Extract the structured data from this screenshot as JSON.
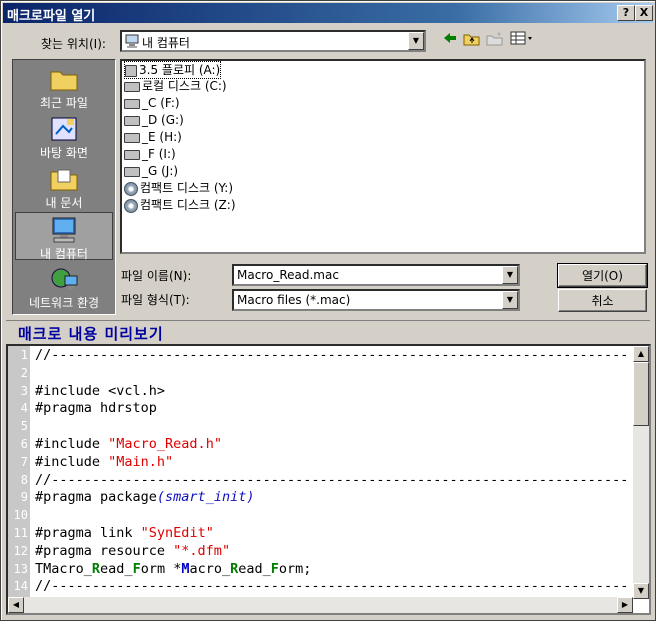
{
  "window": {
    "title": "매크로파일 열기",
    "help_btn": "?",
    "close_btn": "X"
  },
  "lookin": {
    "label": "찾는 위치(I):",
    "value": "내 컴퓨터"
  },
  "places": [
    {
      "label": "최근 파일",
      "icon": "folder-icon"
    },
    {
      "label": "바탕 화면",
      "icon": "desktop-icon"
    },
    {
      "label": "내 문서",
      "icon": "documents-folder-icon"
    },
    {
      "label": "내 컴퓨터",
      "icon": "computer-icon",
      "selected": true
    },
    {
      "label": "네트워크 환경",
      "icon": "network-icon"
    }
  ],
  "files": [
    {
      "name": "3.5 플로피 (A:)",
      "icon": "floppy-icon"
    },
    {
      "name": "로컬 디스크 (C:)",
      "icon": "drive-icon"
    },
    {
      "name": "_C (F:)",
      "icon": "drive-icon"
    },
    {
      "name": "_D (G:)",
      "icon": "drive-icon"
    },
    {
      "name": "_E (H:)",
      "icon": "drive-icon"
    },
    {
      "name": "_F (I:)",
      "icon": "drive-icon"
    },
    {
      "name": "_G (J:)",
      "icon": "drive-icon"
    },
    {
      "name": "컴팩트 디스크 (Y:)",
      "icon": "cd-icon"
    },
    {
      "name": "컴팩트 디스크 (Z:)",
      "icon": "cd-icon"
    }
  ],
  "filename": {
    "label": "파일 이름(N):",
    "value": "Macro_Read.mac"
  },
  "filetype": {
    "label": "파일 형식(T):",
    "value": "Macro files (*.mac)"
  },
  "buttons": {
    "open": "열기(O)",
    "cancel": "취소"
  },
  "preview": {
    "title": "매크로 내용 미리보기"
  },
  "code_lines": [
    {
      "n": "1",
      "parts": [
        [
          "//-----------------------------------------------------------------------",
          ""
        ]
      ]
    },
    {
      "n": "2",
      "parts": [
        [
          "",
          ""
        ]
      ]
    },
    {
      "n": "3",
      "parts": [
        [
          "#include <vcl.h>",
          ""
        ]
      ]
    },
    {
      "n": "4",
      "parts": [
        [
          "#pragma hdrstop",
          ""
        ]
      ]
    },
    {
      "n": "5",
      "parts": [
        [
          "",
          ""
        ]
      ]
    },
    {
      "n": "6",
      "parts": [
        [
          "#include ",
          ""
        ],
        [
          "\"Macro_Read.h\"",
          "str"
        ]
      ]
    },
    {
      "n": "7",
      "parts": [
        [
          "#include ",
          ""
        ],
        [
          "\"Main.h\"",
          "str"
        ]
      ]
    },
    {
      "n": "8",
      "parts": [
        [
          "//-----------------------------------------------------------------------",
          ""
        ]
      ]
    },
    {
      "n": "9",
      "parts": [
        [
          "#pragma package",
          ""
        ],
        [
          "(smart_init)",
          "ital"
        ]
      ]
    },
    {
      "n": "10",
      "parts": [
        [
          "",
          ""
        ]
      ]
    },
    {
      "n": "11",
      "parts": [
        [
          "#pragma link ",
          ""
        ],
        [
          "\"SynEdit\"",
          "str"
        ]
      ]
    },
    {
      "n": "12",
      "parts": [
        [
          "#pragma resource ",
          ""
        ],
        [
          "\"*.dfm\"",
          "str"
        ]
      ]
    },
    {
      "n": "13",
      "parts": [
        [
          "TMacro_",
          ""
        ],
        [
          "R",
          "grn"
        ],
        [
          "ead_",
          ""
        ],
        [
          "F",
          "grn"
        ],
        [
          "orm *",
          ""
        ],
        [
          "M",
          "blu"
        ],
        [
          "acro_",
          ""
        ],
        [
          "R",
          "grn"
        ],
        [
          "ead_",
          ""
        ],
        [
          "F",
          "grn"
        ],
        [
          "orm;",
          ""
        ]
      ]
    },
    {
      "n": "14",
      "parts": [
        [
          "//-----------------------------------------------------------------------",
          ""
        ]
      ]
    }
  ]
}
